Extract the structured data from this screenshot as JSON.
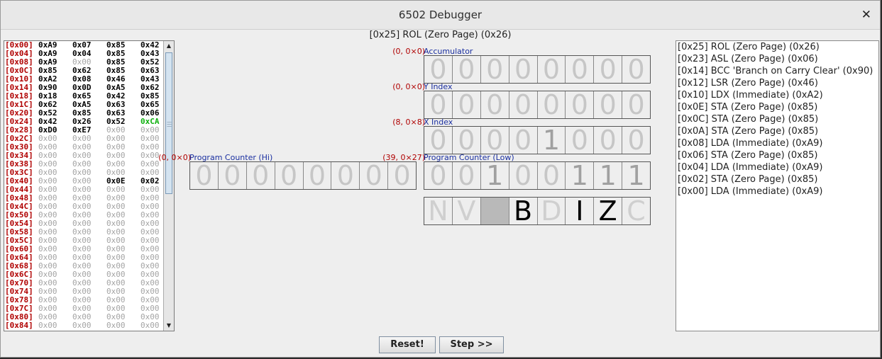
{
  "window": {
    "title": "6502 Debugger",
    "close_glyph": "✕"
  },
  "instruction": "[0x25] ROL (Zero Page) (0x26)",
  "memory": [
    {
      "addr": "[0x00]",
      "cells": [
        {
          "t": "0xA9",
          "s": "v"
        },
        {
          "t": "0x07",
          "s": "v"
        },
        {
          "t": "0x85",
          "s": "v"
        },
        {
          "t": "0x42",
          "s": "v"
        }
      ]
    },
    {
      "addr": "[0x04]",
      "cells": [
        {
          "t": "0xA9",
          "s": "v"
        },
        {
          "t": "0x04",
          "s": "v"
        },
        {
          "t": "0x85",
          "s": "v"
        },
        {
          "t": "0x43",
          "s": "v"
        }
      ]
    },
    {
      "addr": "[0x08]",
      "cells": [
        {
          "t": "0xA9",
          "s": "v"
        },
        {
          "t": "0x00",
          "s": "z"
        },
        {
          "t": "0x85",
          "s": "v"
        },
        {
          "t": "0x52",
          "s": "v"
        }
      ]
    },
    {
      "addr": "[0x0C]",
      "cells": [
        {
          "t": "0x85",
          "s": "v"
        },
        {
          "t": "0x62",
          "s": "v"
        },
        {
          "t": "0x85",
          "s": "v"
        },
        {
          "t": "0x63",
          "s": "v"
        }
      ]
    },
    {
      "addr": "[0x10]",
      "cells": [
        {
          "t": "0xA2",
          "s": "v"
        },
        {
          "t": "0x08",
          "s": "v"
        },
        {
          "t": "0x46",
          "s": "v"
        },
        {
          "t": "0x43",
          "s": "v"
        }
      ]
    },
    {
      "addr": "[0x14]",
      "cells": [
        {
          "t": "0x90",
          "s": "v"
        },
        {
          "t": "0x0D",
          "s": "v"
        },
        {
          "t": "0xA5",
          "s": "v"
        },
        {
          "t": "0x62",
          "s": "v"
        }
      ]
    },
    {
      "addr": "[0x18]",
      "cells": [
        {
          "t": "0x18",
          "s": "v"
        },
        {
          "t": "0x65",
          "s": "v"
        },
        {
          "t": "0x42",
          "s": "v"
        },
        {
          "t": "0x85",
          "s": "v"
        }
      ]
    },
    {
      "addr": "[0x1C]",
      "cells": [
        {
          "t": "0x62",
          "s": "v"
        },
        {
          "t": "0xA5",
          "s": "v"
        },
        {
          "t": "0x63",
          "s": "v"
        },
        {
          "t": "0x65",
          "s": "v"
        }
      ]
    },
    {
      "addr": "[0x20]",
      "cells": [
        {
          "t": "0x52",
          "s": "v"
        },
        {
          "t": "0x85",
          "s": "v"
        },
        {
          "t": "0x63",
          "s": "v"
        },
        {
          "t": "0x06",
          "s": "v"
        }
      ]
    },
    {
      "addr": "[0x24]",
      "cells": [
        {
          "t": "0x42",
          "s": "v"
        },
        {
          "t": "0x26",
          "s": "v"
        },
        {
          "t": "0x52",
          "s": "v"
        },
        {
          "t": "0xCA",
          "s": "hl"
        }
      ]
    },
    {
      "addr": "[0x28]",
      "cells": [
        {
          "t": "0xD0",
          "s": "v"
        },
        {
          "t": "0xE7",
          "s": "v"
        },
        {
          "t": "0x00",
          "s": "z"
        },
        {
          "t": "0x00",
          "s": "z"
        }
      ]
    },
    {
      "addr": "[0x2C]",
      "cells": [
        {
          "t": "0x00",
          "s": "z"
        },
        {
          "t": "0x00",
          "s": "z"
        },
        {
          "t": "0x00",
          "s": "z"
        },
        {
          "t": "0x00",
          "s": "z"
        }
      ]
    },
    {
      "addr": "[0x30]",
      "cells": [
        {
          "t": "0x00",
          "s": "z"
        },
        {
          "t": "0x00",
          "s": "z"
        },
        {
          "t": "0x00",
          "s": "z"
        },
        {
          "t": "0x00",
          "s": "z"
        }
      ]
    },
    {
      "addr": "[0x34]",
      "cells": [
        {
          "t": "0x00",
          "s": "z"
        },
        {
          "t": "0x00",
          "s": "z"
        },
        {
          "t": "0x00",
          "s": "z"
        },
        {
          "t": "0x00",
          "s": "z"
        }
      ]
    },
    {
      "addr": "[0x38]",
      "cells": [
        {
          "t": "0x00",
          "s": "z"
        },
        {
          "t": "0x00",
          "s": "z"
        },
        {
          "t": "0x00",
          "s": "z"
        },
        {
          "t": "0x00",
          "s": "z"
        }
      ]
    },
    {
      "addr": "[0x3C]",
      "cells": [
        {
          "t": "0x00",
          "s": "z"
        },
        {
          "t": "0x00",
          "s": "z"
        },
        {
          "t": "0x00",
          "s": "z"
        },
        {
          "t": "0x00",
          "s": "z"
        }
      ]
    },
    {
      "addr": "[0x40]",
      "cells": [
        {
          "t": "0x00",
          "s": "z"
        },
        {
          "t": "0x00",
          "s": "z"
        },
        {
          "t": "0x0E",
          "s": "v"
        },
        {
          "t": "0x02",
          "s": "v"
        }
      ]
    },
    {
      "addr": "[0x44]",
      "cells": [
        {
          "t": "0x00",
          "s": "z"
        },
        {
          "t": "0x00",
          "s": "z"
        },
        {
          "t": "0x00",
          "s": "z"
        },
        {
          "t": "0x00",
          "s": "z"
        }
      ]
    },
    {
      "addr": "[0x48]",
      "cells": [
        {
          "t": "0x00",
          "s": "z"
        },
        {
          "t": "0x00",
          "s": "z"
        },
        {
          "t": "0x00",
          "s": "z"
        },
        {
          "t": "0x00",
          "s": "z"
        }
      ]
    },
    {
      "addr": "[0x4C]",
      "cells": [
        {
          "t": "0x00",
          "s": "z"
        },
        {
          "t": "0x00",
          "s": "z"
        },
        {
          "t": "0x00",
          "s": "z"
        },
        {
          "t": "0x00",
          "s": "z"
        }
      ]
    },
    {
      "addr": "[0x50]",
      "cells": [
        {
          "t": "0x00",
          "s": "z"
        },
        {
          "t": "0x00",
          "s": "z"
        },
        {
          "t": "0x00",
          "s": "z"
        },
        {
          "t": "0x00",
          "s": "z"
        }
      ]
    },
    {
      "addr": "[0x54]",
      "cells": [
        {
          "t": "0x00",
          "s": "z"
        },
        {
          "t": "0x00",
          "s": "z"
        },
        {
          "t": "0x00",
          "s": "z"
        },
        {
          "t": "0x00",
          "s": "z"
        }
      ]
    },
    {
      "addr": "[0x58]",
      "cells": [
        {
          "t": "0x00",
          "s": "z"
        },
        {
          "t": "0x00",
          "s": "z"
        },
        {
          "t": "0x00",
          "s": "z"
        },
        {
          "t": "0x00",
          "s": "z"
        }
      ]
    },
    {
      "addr": "[0x5C]",
      "cells": [
        {
          "t": "0x00",
          "s": "z"
        },
        {
          "t": "0x00",
          "s": "z"
        },
        {
          "t": "0x00",
          "s": "z"
        },
        {
          "t": "0x00",
          "s": "z"
        }
      ]
    },
    {
      "addr": "[0x60]",
      "cells": [
        {
          "t": "0x00",
          "s": "z"
        },
        {
          "t": "0x00",
          "s": "z"
        },
        {
          "t": "0x00",
          "s": "z"
        },
        {
          "t": "0x00",
          "s": "z"
        }
      ]
    },
    {
      "addr": "[0x64]",
      "cells": [
        {
          "t": "0x00",
          "s": "z"
        },
        {
          "t": "0x00",
          "s": "z"
        },
        {
          "t": "0x00",
          "s": "z"
        },
        {
          "t": "0x00",
          "s": "z"
        }
      ]
    },
    {
      "addr": "[0x68]",
      "cells": [
        {
          "t": "0x00",
          "s": "z"
        },
        {
          "t": "0x00",
          "s": "z"
        },
        {
          "t": "0x00",
          "s": "z"
        },
        {
          "t": "0x00",
          "s": "z"
        }
      ]
    },
    {
      "addr": "[0x6C]",
      "cells": [
        {
          "t": "0x00",
          "s": "z"
        },
        {
          "t": "0x00",
          "s": "z"
        },
        {
          "t": "0x00",
          "s": "z"
        },
        {
          "t": "0x00",
          "s": "z"
        }
      ]
    },
    {
      "addr": "[0x70]",
      "cells": [
        {
          "t": "0x00",
          "s": "z"
        },
        {
          "t": "0x00",
          "s": "z"
        },
        {
          "t": "0x00",
          "s": "z"
        },
        {
          "t": "0x00",
          "s": "z"
        }
      ]
    },
    {
      "addr": "[0x74]",
      "cells": [
        {
          "t": "0x00",
          "s": "z"
        },
        {
          "t": "0x00",
          "s": "z"
        },
        {
          "t": "0x00",
          "s": "z"
        },
        {
          "t": "0x00",
          "s": "z"
        }
      ]
    },
    {
      "addr": "[0x78]",
      "cells": [
        {
          "t": "0x00",
          "s": "z"
        },
        {
          "t": "0x00",
          "s": "z"
        },
        {
          "t": "0x00",
          "s": "z"
        },
        {
          "t": "0x00",
          "s": "z"
        }
      ]
    },
    {
      "addr": "[0x7C]",
      "cells": [
        {
          "t": "0x00",
          "s": "z"
        },
        {
          "t": "0x00",
          "s": "z"
        },
        {
          "t": "0x00",
          "s": "z"
        },
        {
          "t": "0x00",
          "s": "z"
        }
      ]
    },
    {
      "addr": "[0x80]",
      "cells": [
        {
          "t": "0x00",
          "s": "z"
        },
        {
          "t": "0x00",
          "s": "z"
        },
        {
          "t": "0x00",
          "s": "z"
        },
        {
          "t": "0x00",
          "s": "z"
        }
      ]
    },
    {
      "addr": "[0x84]",
      "cells": [
        {
          "t": "0x00",
          "s": "z"
        },
        {
          "t": "0x00",
          "s": "z"
        },
        {
          "t": "0x00",
          "s": "z"
        },
        {
          "t": "0x00",
          "s": "z"
        }
      ]
    }
  ],
  "registers": {
    "pc_hi": {
      "label": "Program Counter (Hi)",
      "value": "(0, 0×0)",
      "bits": [
        "0",
        "0",
        "0",
        "0",
        "0",
        "0",
        "0",
        "0"
      ]
    },
    "acc": {
      "label": "Accumulator",
      "value": "(0, 0×0)",
      "bits": [
        "0",
        "0",
        "0",
        "0",
        "0",
        "0",
        "0",
        "0"
      ]
    },
    "y": {
      "label": "Y Index",
      "value": "(0, 0×0)",
      "bits": [
        "0",
        "0",
        "0",
        "0",
        "0",
        "0",
        "0",
        "0"
      ]
    },
    "x": {
      "label": "X Index",
      "value": "(8, 0×8)",
      "bits": [
        "0",
        "0",
        "0",
        "0",
        "1",
        "0",
        "0",
        "0"
      ]
    },
    "pc_lo": {
      "label": "Program Counter (Low)",
      "value": "(39, 0×27)",
      "bits": [
        "0",
        "0",
        "1",
        "0",
        "0",
        "1",
        "1",
        "1"
      ]
    }
  },
  "flags": [
    {
      "t": "N",
      "set": false,
      "blank": false
    },
    {
      "t": "V",
      "set": false,
      "blank": false
    },
    {
      "t": "",
      "set": false,
      "blank": true
    },
    {
      "t": "B",
      "set": true,
      "blank": false
    },
    {
      "t": "D",
      "set": false,
      "blank": false
    },
    {
      "t": "I",
      "set": true,
      "blank": false
    },
    {
      "t": "Z",
      "set": true,
      "blank": false
    },
    {
      "t": "C",
      "set": false,
      "blank": false
    }
  ],
  "history": [
    "[0x25] ROL (Zero Page) (0x26)",
    "[0x23] ASL (Zero Page) (0x06)",
    "[0x14] BCC 'Branch on Carry Clear' (0x90)",
    "[0x12] LSR (Zero Page) (0x46)",
    "[0x10] LDX (Immediate) (0xA2)",
    "[0x0E] STA (Zero Page) (0x85)",
    "[0x0C] STA (Zero Page) (0x85)",
    "[0x0A] STA (Zero Page) (0x85)",
    "[0x08] LDA (Immediate) (0xA9)",
    "[0x06] STA (Zero Page) (0x85)",
    "[0x04] LDA (Immediate) (0xA9)",
    "[0x02] STA (Zero Page) (0x85)",
    "[0x00] LDA (Immediate) (0xA9)"
  ],
  "buttons": {
    "reset": "Reset!",
    "step": "Step >>"
  }
}
